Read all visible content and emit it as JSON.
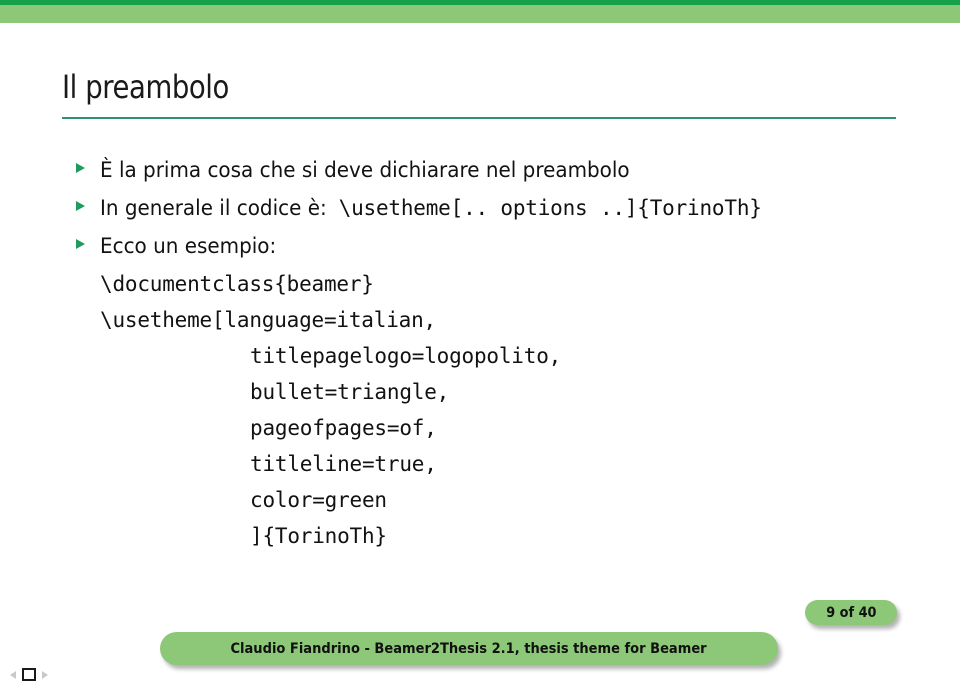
{
  "slide": {
    "title": "Il preambolo",
    "bullets": [
      {
        "text": "È la prima cosa che si deve dichiarare nel preambolo",
        "mono": ""
      },
      {
        "text": "In generale il codice è: ",
        "mono": "\\usetheme[.. options ..]{TorinoTh}"
      },
      {
        "text": "Ecco un esempio:",
        "mono": ""
      }
    ],
    "code_lines": [
      {
        "text": "\\documentclass{beamer}",
        "indent": 1
      },
      {
        "text": "\\usetheme[language=italian,",
        "indent": 1
      },
      {
        "text": "titlepagelogo=logopolito,",
        "indent": 2
      },
      {
        "text": "bullet=triangle,",
        "indent": 2
      },
      {
        "text": "pageofpages=of,",
        "indent": 2
      },
      {
        "text": "titleline=true,",
        "indent": 2
      },
      {
        "text": "color=green",
        "indent": 2
      },
      {
        "text": "]{TorinoTh}",
        "indent": 2
      }
    ]
  },
  "footer": {
    "page_label": "9 of 40",
    "credit": "Claudio Fiandrino - Beamer2Thesis 2.1, thesis theme for Beamer"
  },
  "navigation": {
    "prev_icon": "triangle-left-icon",
    "frame_icon": "frame-square-icon",
    "next_icon": "triangle-right-icon"
  },
  "colors": {
    "header_dark_green": "#17a04a",
    "header_light_green": "#8cc878",
    "title_rule_green": "#2e9272",
    "bullet_green": "#1f9c5d",
    "text_black": "#121212"
  }
}
